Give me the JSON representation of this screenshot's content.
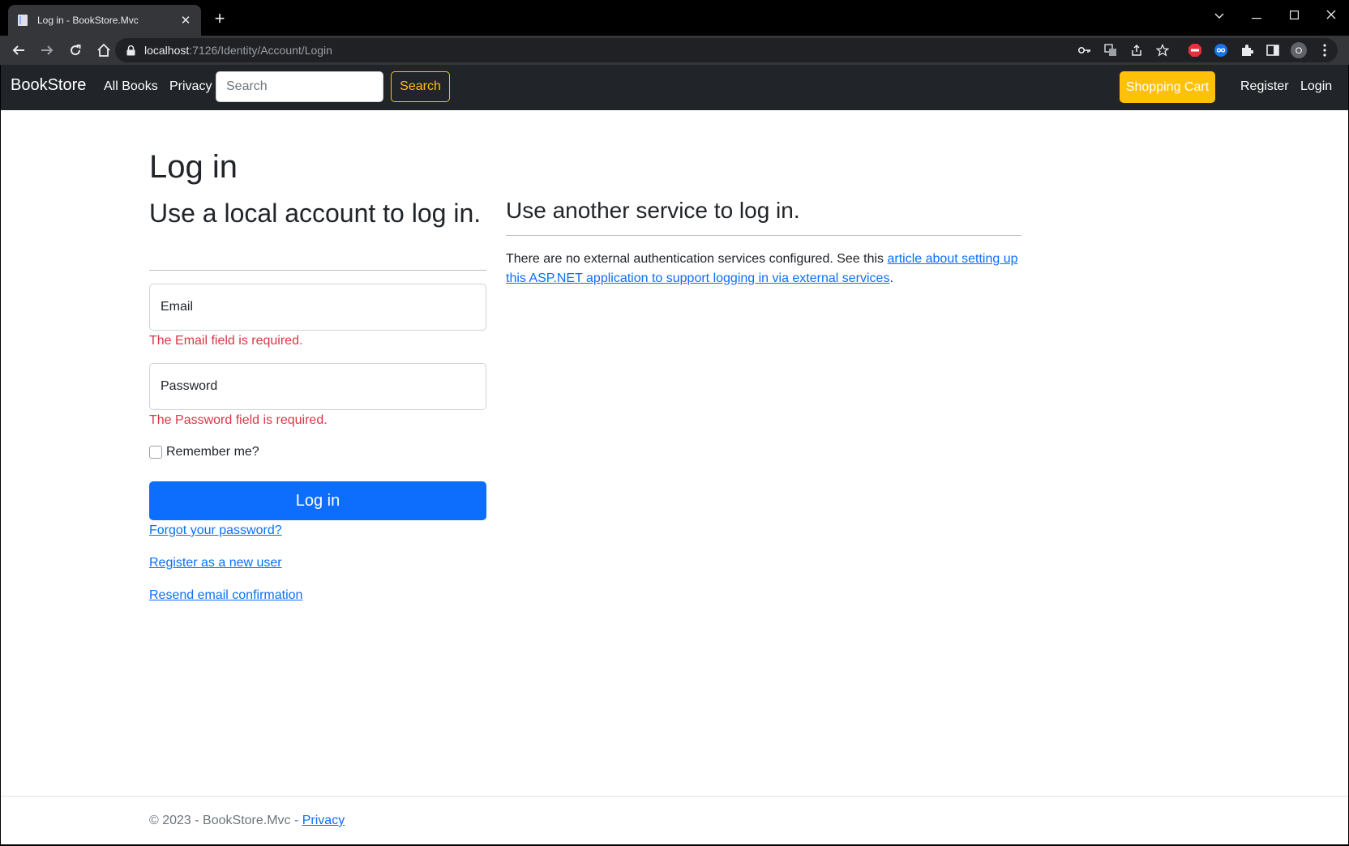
{
  "browser": {
    "tab_title": "Log in - BookStore.Mvc",
    "tab_close": "✕",
    "new_tab": "+",
    "url_host": "localhost",
    "url_rest": ":7126/Identity/Account/Login",
    "profile_initial": "O"
  },
  "navbar": {
    "brand": "BookStore",
    "all_books": "All Books",
    "privacy": "Privacy",
    "search_placeholder": "Search",
    "search_button": "Search",
    "cart_button": "Shopping Cart",
    "register": "Register",
    "login": "Login"
  },
  "main": {
    "title": "Log in",
    "local_heading": "Use a local account to log in.",
    "email_label": "Email",
    "email_error": "The Email field is required.",
    "password_label": "Password",
    "password_error": "The Password field is required.",
    "remember_label": "Remember me?",
    "login_button": "Log in",
    "forgot_link": "Forgot your password?",
    "register_link": "Register as a new user",
    "resend_link": "Resend email confirmation",
    "external_heading": "Use another service to log in.",
    "external_text": "There are no external authentication services configured. See this ",
    "external_link": "article about setting up this ASP.NET application to support logging in via external services",
    "external_text_end": "."
  },
  "footer": {
    "copyright": "© 2023 - BookStore.Mvc - ",
    "privacy_link": "Privacy"
  },
  "colors": {
    "navbar_bg": "#212529",
    "primary": "#0d6efd",
    "warning": "#ffc107",
    "danger": "#dc3545"
  }
}
